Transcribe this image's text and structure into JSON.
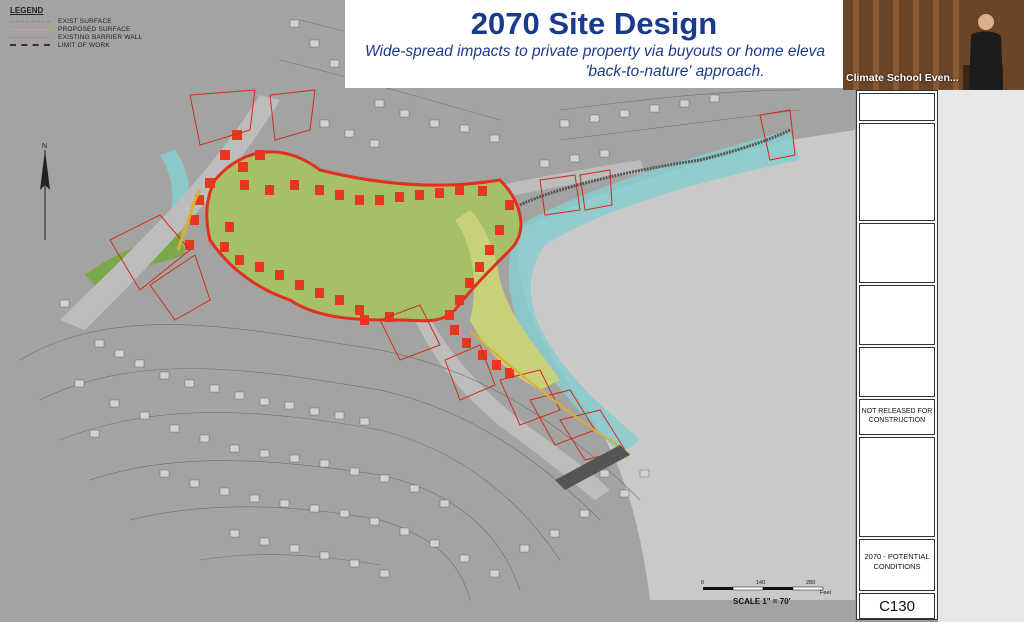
{
  "slide": {
    "title": "2070 Site Design",
    "subtitle_line1": "Wide-spread impacts to private property via buyouts or home eleva",
    "subtitle_line2": "'back-to-nature' approach."
  },
  "legend": {
    "title": "LEGEND",
    "items": [
      {
        "label": "EXIST SURFACE",
        "color": "#8a8a8a",
        "style": "dashed"
      },
      {
        "label": "PROPOSED SURFACE",
        "color": "#d8b030",
        "style": "solid"
      },
      {
        "label": "EXISTING BARRIER WALL",
        "color": "#c07070",
        "style": "dotted"
      },
      {
        "label": "LIMIT OF WORK",
        "color": "#333333",
        "style": "dashdot"
      }
    ]
  },
  "video": {
    "label": "Climate School Even..."
  },
  "title_block": {
    "status": "NOT RELEASED FOR CONSTRUCTION",
    "sheet_name": "2070 - POTENTIAL CONDITIONS",
    "sheet_number": "C130"
  },
  "scale": {
    "label": "SCALE 1\" = 70'",
    "ticks": [
      "0",
      "140",
      "280"
    ],
    "unit": "Feet"
  },
  "colors": {
    "title_blue": "#1a3a8c",
    "buyout_red": "#e03020",
    "park_green": "#a8c060",
    "water_teal": "#7ac8c8"
  }
}
